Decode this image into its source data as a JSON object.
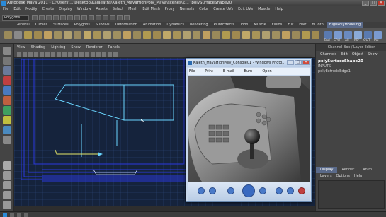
{
  "window": {
    "title": "Autodesk Maya 2011 - C:\\Users\\...\\Desktop\\Kalaeaths\\Kaleth_MayaHighPoly_Maya\\scenes\\Z... \\polySurfaceShape20",
    "buttons": [
      "_",
      "□",
      "✕"
    ]
  },
  "menubar": [
    "File",
    "Edit",
    "Modify",
    "Create",
    "Display",
    "Window",
    "Assets",
    "Select",
    "Mesh",
    "Edit Mesh",
    "Proxy",
    "Normals",
    "Color",
    "Create UVs",
    "Edit UVs",
    "Muscle",
    "Help"
  ],
  "status": {
    "mode": "Polygons"
  },
  "shelf": {
    "tabs": [
      "General",
      "Curves",
      "Surfaces",
      "Polygons",
      "Subdivs",
      "Deformation",
      "Animation",
      "Dynamics",
      "Rendering",
      "PaintEffects",
      "Toon",
      "Muscle",
      "Fluids",
      "Fur",
      "Hair",
      "nCloth",
      "HighPolyModeling"
    ],
    "active_tab": "HighPolyModeling",
    "icon_labels": [
      "Tool",
      "SPol",
      "All",
      "Mir",
      "OUT",
      "Pol"
    ]
  },
  "viewport": {
    "menu": [
      "View",
      "Shading",
      "Lighting",
      "Show",
      "Renderer",
      "Panels"
    ]
  },
  "photo_viewer": {
    "title": "Kaleth_MayaHighPoly_Console01 - Windows Photo...",
    "menu": [
      "File",
      "Print",
      "E-mail",
      "Burn",
      "Open"
    ],
    "buttons": [
      "_",
      "□",
      "✕"
    ]
  },
  "right_panel": {
    "header": "Channel Box / Layer Editor",
    "menu": [
      "Channels",
      "Edit",
      "Object",
      "Show"
    ],
    "selection": "polySurfaceShape20",
    "inputs_label": "INPUTS",
    "input_node": "polyExtrudeEdge1",
    "tabs": [
      "Display",
      "Render",
      "Anim"
    ],
    "active_tab": "Display",
    "sub_menu": [
      "Layers",
      "Options",
      "Help"
    ]
  },
  "colors": {
    "viewport_bg": "#15233c",
    "grid": "#2e4a7a",
    "wire_blue": "#2a3ae0",
    "wire_cyan": "#6ad6ff",
    "active_shelf_tab": "#5a6a8a"
  }
}
